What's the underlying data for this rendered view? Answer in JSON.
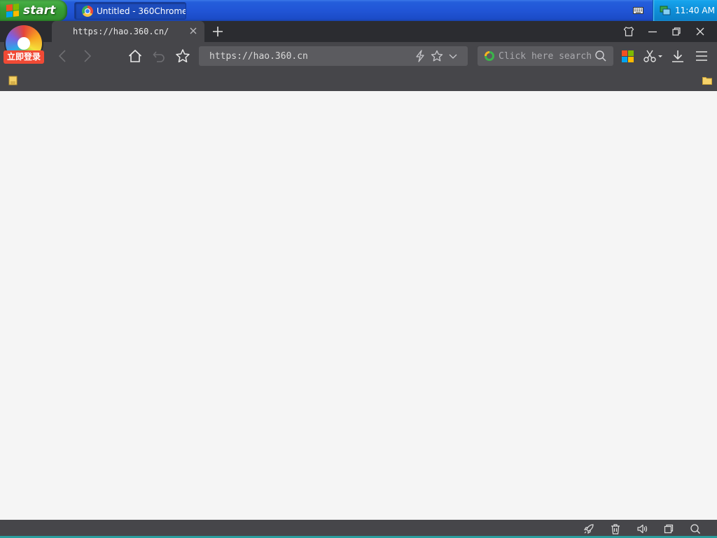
{
  "taskbar": {
    "start_label": "start",
    "task_item_label": "Untitled - 360Chrome…",
    "clock": "11:40 AM"
  },
  "browser": {
    "tab_title": "https://hao.360.cn/",
    "login_badge": "立即登录",
    "address_url": "https://hao.360.cn",
    "search_placeholder": "Click here search"
  },
  "colors": {
    "titlebar": "#2b2c30",
    "toolbar": "#46464a",
    "field": "#5b5b5f",
    "login_badge": "#f04a35",
    "content_bg": "#f5f5f5"
  },
  "icons": {
    "toolbar": [
      "back-icon",
      "forward-icon",
      "home-icon",
      "undo-icon",
      "star-icon",
      "lightning-icon",
      "favorite-icon",
      "chevron-down-icon",
      "search-icon",
      "apps-icon",
      "scissors-icon",
      "download-icon",
      "menu-icon"
    ],
    "statusbar": [
      "rocket-icon",
      "trash-icon",
      "speaker-icon",
      "window-icon",
      "zoom-icon"
    ]
  }
}
